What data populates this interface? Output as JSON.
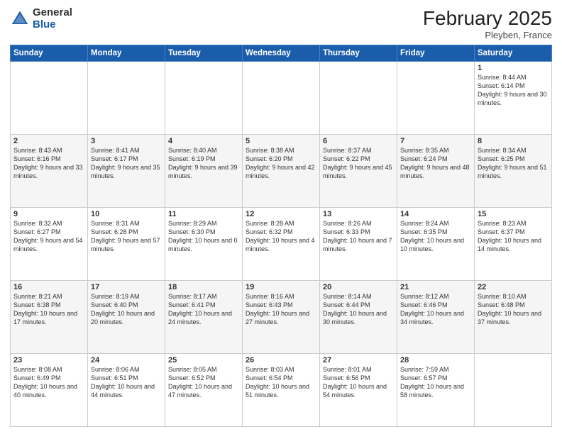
{
  "logo": {
    "general": "General",
    "blue": "Blue"
  },
  "title": "February 2025",
  "location": "Pleyben, France",
  "days_header": [
    "Sunday",
    "Monday",
    "Tuesday",
    "Wednesday",
    "Thursday",
    "Friday",
    "Saturday"
  ],
  "weeks": [
    [
      {
        "day": "",
        "info": ""
      },
      {
        "day": "",
        "info": ""
      },
      {
        "day": "",
        "info": ""
      },
      {
        "day": "",
        "info": ""
      },
      {
        "day": "",
        "info": ""
      },
      {
        "day": "",
        "info": ""
      },
      {
        "day": "1",
        "info": "Sunrise: 8:44 AM\nSunset: 6:14 PM\nDaylight: 9 hours and 30 minutes."
      }
    ],
    [
      {
        "day": "2",
        "info": "Sunrise: 8:43 AM\nSunset: 6:16 PM\nDaylight: 9 hours and 33 minutes."
      },
      {
        "day": "3",
        "info": "Sunrise: 8:41 AM\nSunset: 6:17 PM\nDaylight: 9 hours and 35 minutes."
      },
      {
        "day": "4",
        "info": "Sunrise: 8:40 AM\nSunset: 6:19 PM\nDaylight: 9 hours and 39 minutes."
      },
      {
        "day": "5",
        "info": "Sunrise: 8:38 AM\nSunset: 6:20 PM\nDaylight: 9 hours and 42 minutes."
      },
      {
        "day": "6",
        "info": "Sunrise: 8:37 AM\nSunset: 6:22 PM\nDaylight: 9 hours and 45 minutes."
      },
      {
        "day": "7",
        "info": "Sunrise: 8:35 AM\nSunset: 6:24 PM\nDaylight: 9 hours and 48 minutes."
      },
      {
        "day": "8",
        "info": "Sunrise: 8:34 AM\nSunset: 6:25 PM\nDaylight: 9 hours and 51 minutes."
      }
    ],
    [
      {
        "day": "9",
        "info": "Sunrise: 8:32 AM\nSunset: 6:27 PM\nDaylight: 9 hours and 54 minutes."
      },
      {
        "day": "10",
        "info": "Sunrise: 8:31 AM\nSunset: 6:28 PM\nDaylight: 9 hours and 57 minutes."
      },
      {
        "day": "11",
        "info": "Sunrise: 8:29 AM\nSunset: 6:30 PM\nDaylight: 10 hours and 0 minutes."
      },
      {
        "day": "12",
        "info": "Sunrise: 8:28 AM\nSunset: 6:32 PM\nDaylight: 10 hours and 4 minutes."
      },
      {
        "day": "13",
        "info": "Sunrise: 8:26 AM\nSunset: 6:33 PM\nDaylight: 10 hours and 7 minutes."
      },
      {
        "day": "14",
        "info": "Sunrise: 8:24 AM\nSunset: 6:35 PM\nDaylight: 10 hours and 10 minutes."
      },
      {
        "day": "15",
        "info": "Sunrise: 8:23 AM\nSunset: 6:37 PM\nDaylight: 10 hours and 14 minutes."
      }
    ],
    [
      {
        "day": "16",
        "info": "Sunrise: 8:21 AM\nSunset: 6:38 PM\nDaylight: 10 hours and 17 minutes."
      },
      {
        "day": "17",
        "info": "Sunrise: 8:19 AM\nSunset: 6:40 PM\nDaylight: 10 hours and 20 minutes."
      },
      {
        "day": "18",
        "info": "Sunrise: 8:17 AM\nSunset: 6:41 PM\nDaylight: 10 hours and 24 minutes."
      },
      {
        "day": "19",
        "info": "Sunrise: 8:16 AM\nSunset: 6:43 PM\nDaylight: 10 hours and 27 minutes."
      },
      {
        "day": "20",
        "info": "Sunrise: 8:14 AM\nSunset: 6:44 PM\nDaylight: 10 hours and 30 minutes."
      },
      {
        "day": "21",
        "info": "Sunrise: 8:12 AM\nSunset: 6:46 PM\nDaylight: 10 hours and 34 minutes."
      },
      {
        "day": "22",
        "info": "Sunrise: 8:10 AM\nSunset: 6:48 PM\nDaylight: 10 hours and 37 minutes."
      }
    ],
    [
      {
        "day": "23",
        "info": "Sunrise: 8:08 AM\nSunset: 6:49 PM\nDaylight: 10 hours and 40 minutes."
      },
      {
        "day": "24",
        "info": "Sunrise: 8:06 AM\nSunset: 6:51 PM\nDaylight: 10 hours and 44 minutes."
      },
      {
        "day": "25",
        "info": "Sunrise: 8:05 AM\nSunset: 6:52 PM\nDaylight: 10 hours and 47 minutes."
      },
      {
        "day": "26",
        "info": "Sunrise: 8:03 AM\nSunset: 6:54 PM\nDaylight: 10 hours and 51 minutes."
      },
      {
        "day": "27",
        "info": "Sunrise: 8:01 AM\nSunset: 6:56 PM\nDaylight: 10 hours and 54 minutes."
      },
      {
        "day": "28",
        "info": "Sunrise: 7:59 AM\nSunset: 6:57 PM\nDaylight: 10 hours and 58 minutes."
      },
      {
        "day": "",
        "info": ""
      }
    ]
  ]
}
